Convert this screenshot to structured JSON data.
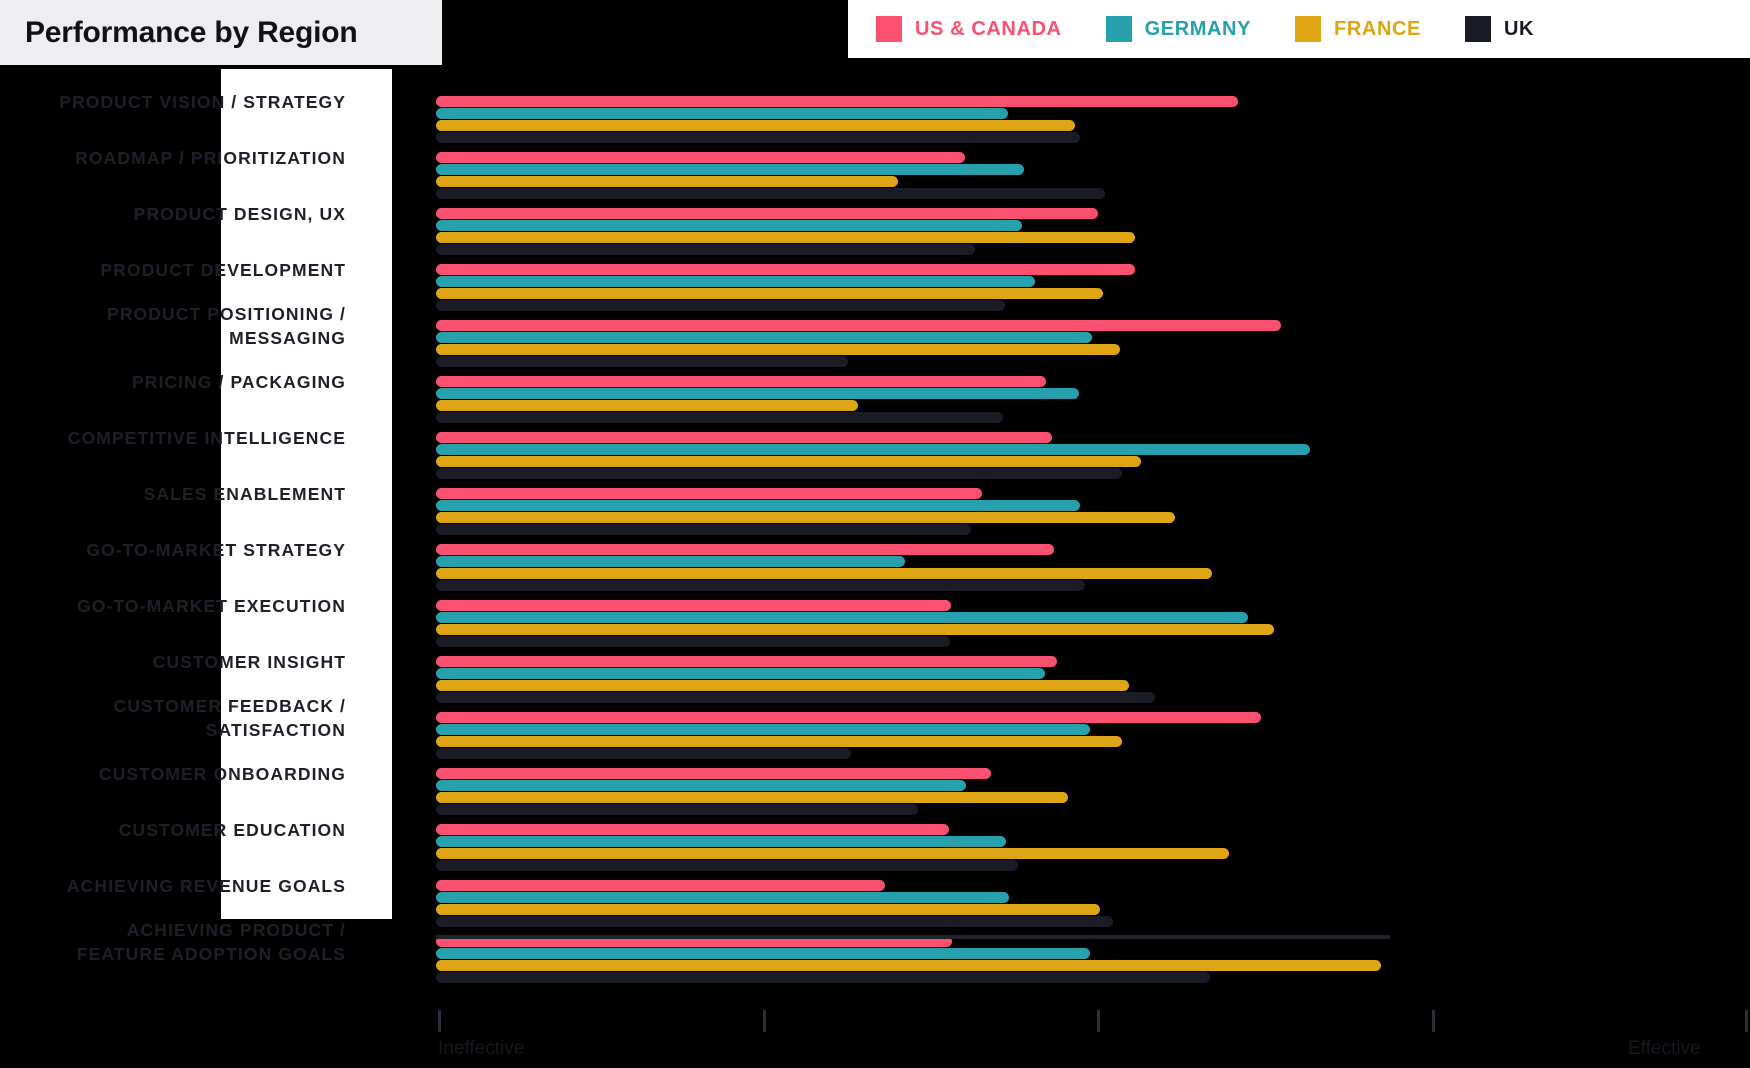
{
  "header": {
    "title": "Performance by Region"
  },
  "legend": {
    "items": [
      {
        "label": "US & CANADA",
        "color": "#FB5070"
      },
      {
        "label": "GERMANY",
        "color": "#27A0AE"
      },
      {
        "label": "FRANCE",
        "color": "#DFA413"
      },
      {
        "label": "UK",
        "color": "#191C24"
      }
    ]
  },
  "axis": {
    "left_label": "Ineffective",
    "right_label": "Effective",
    "ticks": [
      438,
      763,
      1097,
      1432
    ],
    "min": 0,
    "max": 100
  },
  "chart_data": {
    "type": "bar",
    "title": "Performance by Region",
    "xlabel": "Ineffective → Effective",
    "ylabel": "",
    "orientation": "horizontal",
    "grouped": true,
    "grid": false,
    "legend_position": "top-right",
    "xlim": [
      0,
      100
    ],
    "categories": [
      "PRODUCT VISION / STRATEGY",
      "ROADMAP / PRIORITIZATION",
      "PRODUCT DESIGN, UX",
      "PRODUCT DEVELOPMENT",
      "PRODUCT POSITIONING /\nMESSAGING",
      "PRICING / PACKAGING",
      "COMPETITIVE INTELLIGENCE",
      "SALES ENABLEMENT",
      "GO-TO-MARKET STRATEGY",
      "GO-TO-MARKET EXECUTION",
      "CUSTOMER INSIGHT",
      "CUSTOMER FEEDBACK /\nSATISFACTION",
      "CUSTOMER ONBOARDING",
      "CUSTOMER EDUCATION",
      "ACHIEVING REVENUE GOALS",
      "ACHIEVING PRODUCT /\nFEATURE ADOPTION GOALS"
    ],
    "series": [
      {
        "name": "US & CANADA",
        "color": "#FB5070",
        "values": [
          75.4,
          49.7,
          62.2,
          65.7,
          79.4,
          57.3,
          57.9,
          51.3,
          58.1,
          48.4,
          58.4,
          77.5,
          52.2,
          48.2,
          42.2,
          48.5
        ]
      },
      {
        "name": "GERMANY",
        "color": "#27A0AE",
        "values": [
          53.8,
          55.3,
          55.1,
          56.3,
          61.7,
          60.4,
          82.1,
          60.5,
          44.1,
          76.3,
          57.2,
          61.5,
          49.8,
          53.6,
          53.9,
          61.5
        ]
      },
      {
        "name": "FRANCE",
        "color": "#DFA413",
        "values": [
          60.1,
          43.4,
          65.7,
          62.7,
          64.3,
          39.7,
          66.3,
          69.5,
          72.9,
          78.8,
          65.1,
          64.5,
          59.4,
          74.5,
          62.4,
          88.8
        ]
      },
      {
        "name": "UK",
        "color": "#191C24",
        "values": [
          60.5,
          62.9,
          50.7,
          53.5,
          38.7,
          53.3,
          64.5,
          50.3,
          61.0,
          48.3,
          67.6,
          39.0,
          45.3,
          54.7,
          63.6,
          72.7
        ]
      }
    ]
  }
}
